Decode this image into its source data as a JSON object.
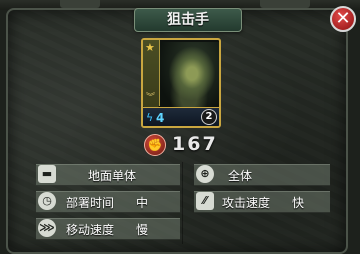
{
  "unit": {
    "name": "狙击手",
    "energy_cost": "4",
    "level": "2",
    "power": "167"
  },
  "stats": {
    "target_type": "地面单体",
    "target_range": "全体",
    "deploy_time_label": "部署时间",
    "deploy_time_value": "中",
    "attack_speed_label": "攻击速度",
    "attack_speed_value": "快",
    "move_speed_label": "移动速度",
    "move_speed_value": "慢"
  },
  "icons": {
    "close": "close-icon",
    "star": "star-icon",
    "energy": "lightning-icon",
    "power": "fist-icon",
    "tank": "tank-icon",
    "target": "crosshair-icon",
    "timer": "stopwatch-icon",
    "attack": "bullets-icon",
    "move": "boot-icon"
  },
  "colors": {
    "card_border": "#c9a640",
    "energy": "#5fd4ff",
    "close_button": "#c22a2a"
  }
}
